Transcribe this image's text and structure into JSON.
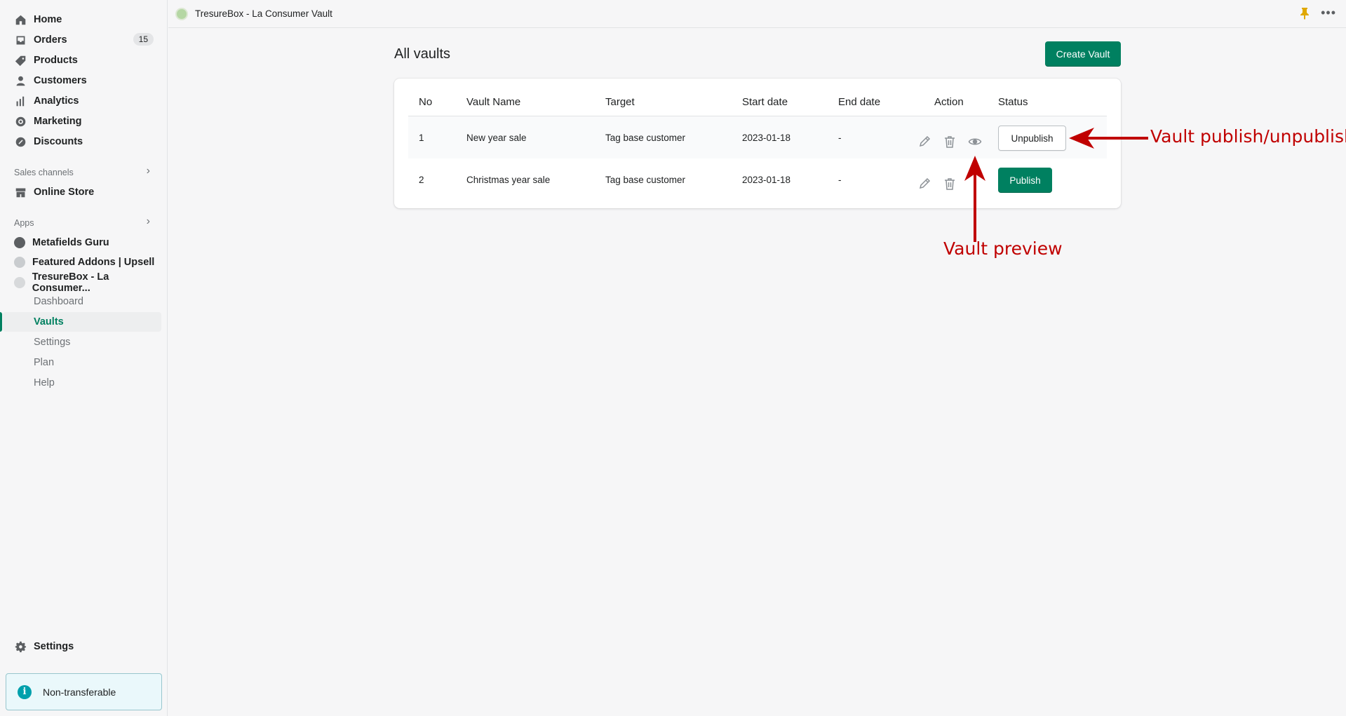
{
  "topbar": {
    "app_title": "TresureBox - La Consumer Vault",
    "more_label": "•••"
  },
  "sidebar": {
    "nav": [
      {
        "label": "Home",
        "icon": "home-icon"
      },
      {
        "label": "Orders",
        "icon": "orders-icon",
        "badge": "15"
      },
      {
        "label": "Products",
        "icon": "tag-icon"
      },
      {
        "label": "Customers",
        "icon": "person-icon"
      },
      {
        "label": "Analytics",
        "icon": "bar-chart-icon"
      },
      {
        "label": "Marketing",
        "icon": "target-icon"
      },
      {
        "label": "Discounts",
        "icon": "discount-icon"
      }
    ],
    "sales_channels_label": "Sales channels",
    "online_store_label": "Online Store",
    "apps_label": "Apps",
    "apps": [
      {
        "label": "Metafields Guru"
      },
      {
        "label": "Featured Addons | Upsell"
      },
      {
        "label": "TresureBox - La Consumer..."
      }
    ],
    "sub_items": [
      {
        "label": "Dashboard"
      },
      {
        "label": "Vaults",
        "active": true
      },
      {
        "label": "Settings"
      },
      {
        "label": "Plan"
      },
      {
        "label": "Help"
      }
    ],
    "settings_label": "Settings",
    "notice_label": "Non-transferable",
    "notice_icon_glyph": "i",
    "chevron_glyph": "›"
  },
  "main": {
    "title": "All vaults",
    "create_button": "Create Vault",
    "table": {
      "headers": [
        "No",
        "Vault Name",
        "Target",
        "Start date",
        "End date",
        "Action",
        "Status"
      ],
      "rows": [
        {
          "no": "1",
          "name": "New year sale",
          "target": "Tag base customer",
          "start": "2023-01-18",
          "end": "-",
          "status_button": "Unpublish"
        },
        {
          "no": "2",
          "name": "Christmas year sale",
          "target": "Tag base customer",
          "start": "2023-01-18",
          "end": "-",
          "status_button": "Publish"
        }
      ]
    }
  },
  "annotations": {
    "publish_label": "Vault publish/unpublish",
    "preview_label": "Vault preview",
    "color": "#c00000"
  },
  "colors": {
    "accent": "#008060",
    "sidebar_bg": "#f6f6f7",
    "annotation": "#c00000"
  }
}
